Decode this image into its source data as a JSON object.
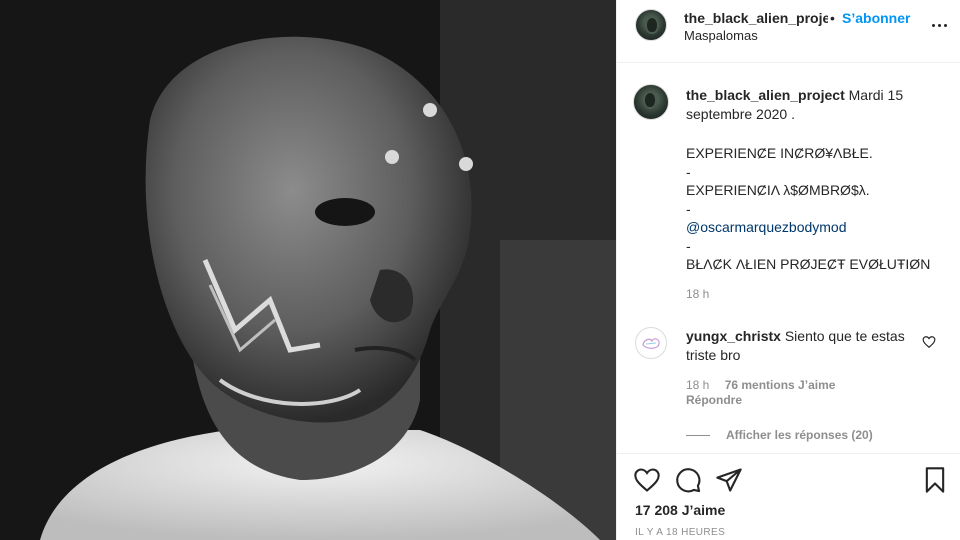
{
  "header": {
    "username": "the_black_alien_project",
    "separator": "•",
    "follow_label": "S’abonner",
    "location": "Maspalomas"
  },
  "caption": {
    "username": "the_black_alien_project",
    "date_text": "Mardi 15 septembre 2020 .",
    "lines": [
      "EXPERIENȻE INȻRØ¥ΛBŁE.",
      "-",
      "EXPERIENȻIΛ λ$ØMBRØ$λ.",
      "-",
      "@oscarmarquezbodymod",
      "-",
      "BŁΛȻK ΛŁIEN PRØJEȻŦ EVØŁUŦIØN"
    ],
    "time": "18 h"
  },
  "comment": {
    "username": "yungx_christx",
    "text": "Siento que te estas triste bro",
    "time": "18 h",
    "likes": "76 mentions J’aime",
    "reply_label": "Répondre",
    "view_replies": "Afficher les réponses (20)"
  },
  "footer": {
    "likes": "17 208 J’aime",
    "ago": "IL Y A 18 HEURES"
  },
  "icons": {
    "like": "heart-icon",
    "comment": "comment-icon",
    "share": "paper-plane-icon",
    "save": "bookmark-icon",
    "more": "more-options-icon"
  },
  "colors": {
    "accent": "#0095f6",
    "mention": "#00376b",
    "muted": "#8e8e8e",
    "text": "#262626"
  }
}
